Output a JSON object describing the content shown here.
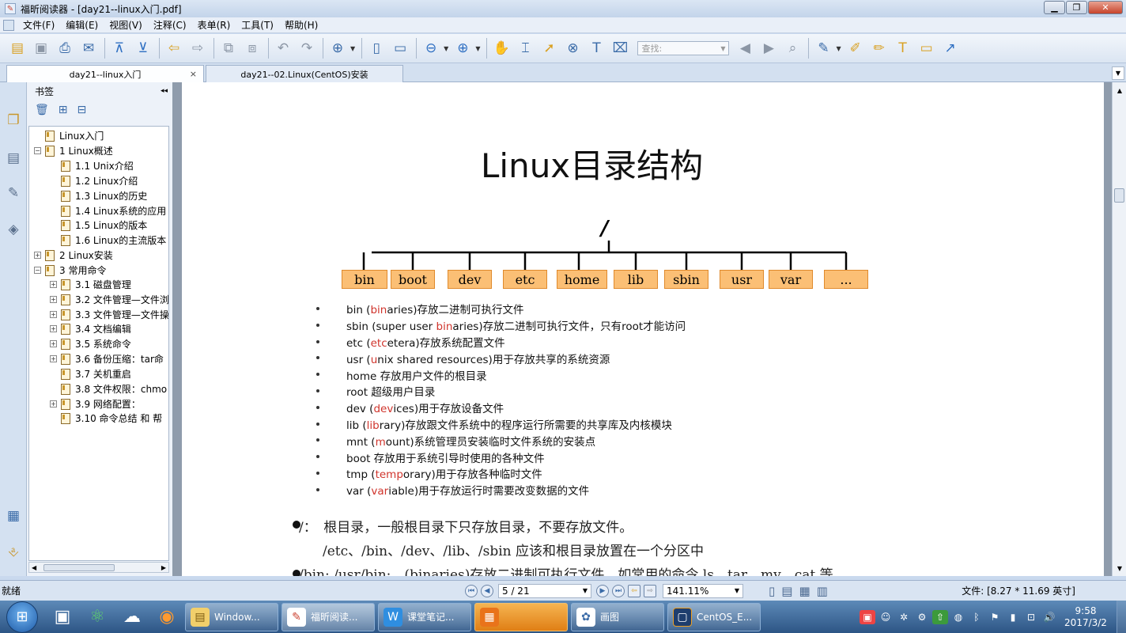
{
  "window": {
    "title": "福昕阅读器 - [day21--linux入门.pdf]",
    "minimize": "▁",
    "restore": "❐",
    "close": "✕"
  },
  "menu": [
    "文件(F)",
    "编辑(E)",
    "视图(V)",
    "注释(C)",
    "表单(R)",
    "工具(T)",
    "帮助(H)"
  ],
  "toolbar": {
    "search_placeholder": "查找:"
  },
  "tabs": [
    {
      "label": "day21--linux入门",
      "close": "×"
    },
    {
      "label": "day21--02.Linux(CentOS)安装"
    }
  ],
  "bookmarks": {
    "title": "书签",
    "collapse": "◂◂",
    "items": [
      {
        "label": "Linux入门",
        "expander": ""
      },
      {
        "label": "1 Linux概述",
        "expander": "−"
      },
      {
        "label": "1.1 Unix介绍",
        "expander": ""
      },
      {
        "label": "1.2 Linux介绍",
        "expander": ""
      },
      {
        "label": "1.3 Linux的历史",
        "expander": ""
      },
      {
        "label": "1.4 Linux系统的应用",
        "expander": ""
      },
      {
        "label": "1.5 Linux的版本",
        "expander": ""
      },
      {
        "label": "1.6 Linux的主流版本",
        "expander": ""
      },
      {
        "label": "2 Linux安装",
        "expander": "+"
      },
      {
        "label": "3 常用命令",
        "expander": "−"
      },
      {
        "label": "3.1 磁盘管理",
        "expander": "+"
      },
      {
        "label": "3.2 文件管理—文件浏",
        "expander": "+"
      },
      {
        "label": "3.3 文件管理—文件操",
        "expander": "+"
      },
      {
        "label": "3.4 文档编辑",
        "expander": "+"
      },
      {
        "label": "3.5 系统命令",
        "expander": "+"
      },
      {
        "label": "3.6 备份压缩：tar命",
        "expander": "+"
      },
      {
        "label": "3.7 关机重启",
        "expander": ""
      },
      {
        "label": "3.8 文件权限：chmo",
        "expander": ""
      },
      {
        "label": "3.9 网络配置：",
        "expander": "+"
      },
      {
        "label": "3.10 命令总结 和 帮",
        "expander": ""
      }
    ]
  },
  "document": {
    "title": "Linux目录结构",
    "root": "/",
    "dirs": [
      "bin",
      "boot",
      "dev",
      "etc",
      "home",
      "lib",
      "sbin",
      "usr",
      "var",
      "..."
    ],
    "bullets": [
      {
        "pre": "bin (",
        "red": "bin",
        "post": "aries)存放二进制可执行文件"
      },
      {
        "pre": "sbin (super user ",
        "red": "bin",
        "post": "aries)存放二进制可执行文件，只有root才能访问"
      },
      {
        "pre": "etc (",
        "red": "etc",
        "post": "etera)存放系统配置文件"
      },
      {
        "pre": "usr (",
        "red": "u",
        "post": "nix shared resources)用于存放共享的系统资源"
      },
      {
        "pre": "home 存放用户文件的根目录",
        "red": "",
        "post": ""
      },
      {
        "pre": "root 超级用户目录",
        "red": "",
        "post": ""
      },
      {
        "pre": "dev (",
        "red": "dev",
        "post": "ices)用于存放设备文件"
      },
      {
        "pre": "lib (",
        "red": "lib",
        "post": "rary)存放跟文件系统中的程序运行所需要的共享库及内核模块"
      },
      {
        "pre": "mnt (",
        "red": "m",
        "post": "ount)系统管理员安装临时文件系统的安装点"
      },
      {
        "pre": "boot 存放用于系统引导时使用的各种文件",
        "red": "",
        "post": ""
      },
      {
        "pre": "tmp (",
        "red": "temp",
        "post": "orary)用于存放各种临时文件"
      },
      {
        "pre": "var (",
        "red": "var",
        "post": "iable)用于存放运行时需要改变数据的文件"
      }
    ],
    "para1": "/：　根目录，一般根目录下只存放目录，不要存放文件。",
    "para2": "/etc、/bin、/dev、/lib、/sbin 应该和根目录放置在一个分区中",
    "para3": "/bin: /usr/bin:　(binaries)存放二进制可执行文件，如常用的命令 ls、tar、mv、cat 等。"
  },
  "status": {
    "ready": "就绪",
    "page": "5 / 21",
    "zoom": "141.11%",
    "filesize": "文件: [8.27 * 11.69 英寸]"
  },
  "taskbar": {
    "tasks": [
      "Window...",
      "福昕阅读...",
      "课堂笔记...",
      "",
      "画图",
      "CentOS_E..."
    ],
    "time": "9:58",
    "date": "2017/3/2"
  }
}
